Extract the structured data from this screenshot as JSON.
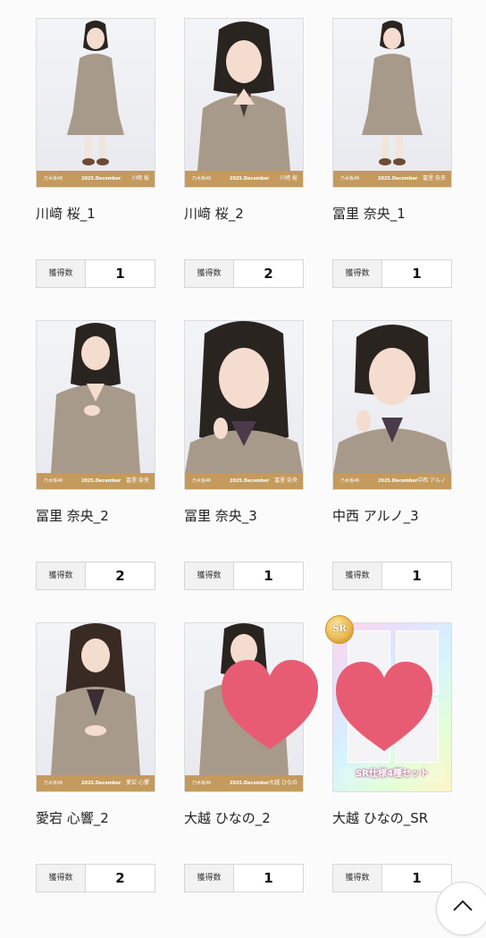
{
  "items": [
    {
      "name": "川﨑 桜_1",
      "count_label": "獲得数",
      "count": "1",
      "strip_brand": "乃木坂46",
      "strip_date": "2025.December",
      "strip_name": "川﨑 桜"
    },
    {
      "name": "川﨑 桜_2",
      "count_label": "獲得数",
      "count": "2",
      "strip_brand": "乃木坂46",
      "strip_date": "2025.December",
      "strip_name": "川﨑 桜"
    },
    {
      "name": "冨里 奈央_1",
      "count_label": "獲得数",
      "count": "1",
      "strip_brand": "乃木坂46",
      "strip_date": "2025.December",
      "strip_name": "冨里 奈央"
    },
    {
      "name": "冨里 奈央_2",
      "count_label": "獲得数",
      "count": "2",
      "strip_brand": "乃木坂46",
      "strip_date": "2025.December",
      "strip_name": "冨里 奈央"
    },
    {
      "name": "冨里 奈央_3",
      "count_label": "獲得数",
      "count": "1",
      "strip_brand": "乃木坂46",
      "strip_date": "2025.December",
      "strip_name": "冨里 奈央"
    },
    {
      "name": "中西 アルノ_3",
      "count_label": "獲得数",
      "count": "1",
      "strip_brand": "乃木坂46",
      "strip_date": "2025.December",
      "strip_name": "中西 アルノ"
    },
    {
      "name": "愛宕 心響_2",
      "count_label": "獲得数",
      "count": "2",
      "strip_brand": "乃木坂46",
      "strip_date": "2025.December",
      "strip_name": "愛宕 心響"
    },
    {
      "name": "大越 ひなの_2",
      "count_label": "獲得数",
      "count": "1",
      "strip_brand": "乃木坂46",
      "strip_date": "2025.December",
      "strip_name": "大越 ひなの"
    },
    {
      "name": "大越 ひなの_SR",
      "count_label": "獲得数",
      "count": "1",
      "sr_badge": "SR",
      "sr_caption": "SR仕様4種セット"
    }
  ],
  "colors": {
    "strip": "#c49a5d",
    "heart": "#e85c73",
    "jacket": "#a89a8a"
  },
  "icons": {
    "scroll_top": "chevron-up-icon",
    "overlay": "heart-icon"
  }
}
